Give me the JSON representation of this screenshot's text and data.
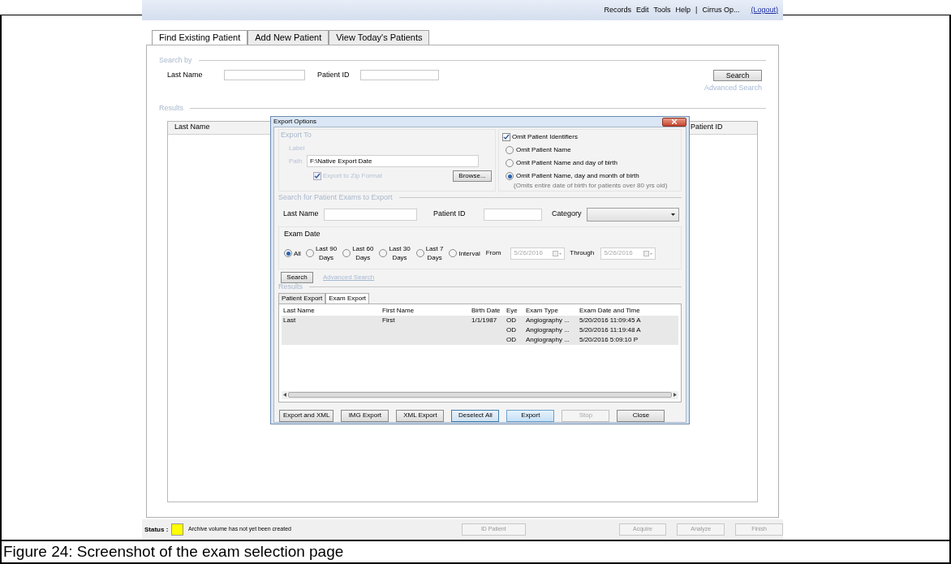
{
  "menu": {
    "items": [
      "Records",
      "Edit",
      "Tools",
      "Help"
    ],
    "separator": "|",
    "user": "Cirrus Op...",
    "logout": "(Logout)"
  },
  "tabs": [
    {
      "label": "Find Existing Patient",
      "selected": true
    },
    {
      "label": "Add New Patient",
      "selected": false
    },
    {
      "label": "View Today's Patients",
      "selected": false
    }
  ],
  "search": {
    "title": "Search by",
    "fields": [
      {
        "label": "Last Name"
      },
      {
        "label": "Patient ID"
      }
    ],
    "button": "Search",
    "advanced": "Advanced Search"
  },
  "results": {
    "title": "Results",
    "columns": [
      "Last Name",
      "Patient ID"
    ]
  },
  "dialog": {
    "title": "Export Options",
    "export_to": {
      "title": "Export To",
      "label_label": "Label",
      "path_label": "Path",
      "path": "F:\\Native Export Date",
      "zip": {
        "label": "Export to Zip Format",
        "checked": true
      },
      "browse": "Browse..."
    },
    "omit": {
      "label": "Omit Patient Identifiers",
      "checked": true,
      "options": [
        {
          "label": "Omit Patient Name",
          "selected": false
        },
        {
          "label": "Omit Patient Name and day of birth",
          "selected": false
        },
        {
          "label": "Omit Patient Name, day and month of birth",
          "selected": true
        }
      ],
      "note": "(Omits entire date of birth for patients over 80 yrs old)"
    },
    "exam_search": {
      "title": "Search for Patient Exams to Export",
      "fields": [
        {
          "label": "Last Name"
        },
        {
          "label": "Patient ID"
        }
      ],
      "category_label": "Category",
      "exam_date": {
        "title": "Exam Date",
        "options": [
          {
            "label": "All",
            "selected": true
          },
          {
            "label": "Last 90\nDays",
            "selected": false
          },
          {
            "label": "Last 60\nDays",
            "selected": false
          },
          {
            "label": "Last 30\nDays",
            "selected": false
          },
          {
            "label": "Last 7\nDays",
            "selected": false
          },
          {
            "label": "Interval",
            "selected": false
          }
        ],
        "from_label": "From",
        "from": "5/26/2016",
        "through_label": "Through",
        "through": "5/26/2016"
      },
      "button": "Search",
      "advanced": "Advanced Search"
    },
    "results_title": "Results",
    "result_tabs": [
      {
        "label": "Patient Export",
        "selected": false
      },
      {
        "label": "Exam Export",
        "selected": true
      }
    ],
    "columns": [
      "Last Name",
      "First Name",
      "Birth Date",
      "Eye",
      "Exam Type",
      "Exam Date and Time"
    ],
    "rows": [
      {
        "selected": true,
        "last_name": "Last",
        "first_name": "First",
        "birth_date": "1/1/1987",
        "eye": "OD",
        "exam_type": "Angiography ...",
        "exam_time": "5/20/2016 11:09:45 A"
      },
      {
        "selected": true,
        "eye": "OD",
        "exam_type": "Angiography ...",
        "exam_time": "5/20/2016 11:19:48 A"
      },
      {
        "selected": true,
        "eye": "OD",
        "exam_type": "Angiography ...",
        "exam_time": "5/20/2016 5:09:10 P"
      }
    ],
    "buttons": [
      {
        "label": "Export and XML",
        "kind": "normal"
      },
      {
        "label": "IMG Export",
        "kind": "normal"
      },
      {
        "label": "XML Export",
        "kind": "normal"
      },
      {
        "label": "Deselect All",
        "kind": "focused"
      },
      {
        "label": "Export",
        "kind": "primary"
      },
      {
        "label": "Stop",
        "kind": "disabled"
      },
      {
        "label": "Close",
        "kind": "normal"
      }
    ]
  },
  "status": {
    "label": "Status :",
    "color": "#ffff00",
    "message": "Archive volume has not yet been created",
    "buttons": [
      {
        "label": "ID Patient",
        "disabled": true
      },
      {
        "label": "Acquire",
        "disabled": true
      },
      {
        "label": "Analyze",
        "disabled": true
      },
      {
        "label": "Finish",
        "disabled": true
      }
    ]
  },
  "caption": "Figure 24: Screenshot of the exam selection page"
}
